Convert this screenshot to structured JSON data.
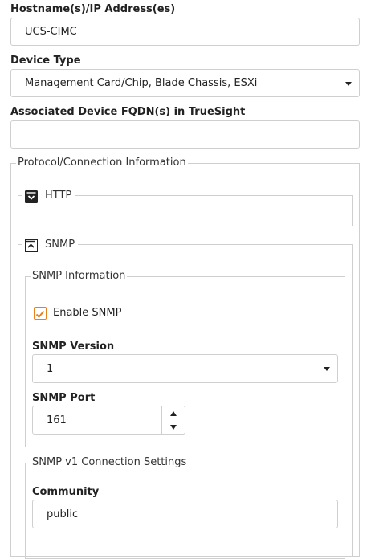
{
  "hostname": {
    "label": "Hostname(s)/IP Address(es)",
    "value": "UCS-CIMC"
  },
  "device_type": {
    "label": "Device Type",
    "value": "Management Card/Chip, Blade Chassis, ESXi"
  },
  "fqdn": {
    "label": "Associated Device FQDN(s) in TrueSight",
    "value": ""
  },
  "protocol": {
    "legend": "Protocol/Connection Information",
    "http": {
      "label": "HTTP",
      "expanded": false
    },
    "snmp": {
      "label": "SNMP",
      "expanded": true,
      "info": {
        "legend": "SNMP Information",
        "enable_label": "Enable SNMP",
        "enabled": true,
        "version_label": "SNMP Version",
        "version_value": "1",
        "port_label": "SNMP Port",
        "port_value": "161"
      },
      "v1": {
        "legend": "SNMP v1 Connection Settings",
        "community_label": "Community",
        "community_value": "public"
      }
    }
  },
  "colors": {
    "accent": "#e8801c",
    "border": "#cfcfcf",
    "toggle": "#222222"
  }
}
